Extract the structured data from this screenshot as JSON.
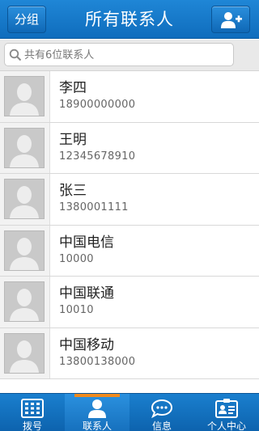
{
  "header": {
    "title": "所有联系人",
    "group_button": "分组",
    "add_icon": "add-contact-icon"
  },
  "search": {
    "placeholder": "共有6位联系人",
    "icon": "search-icon"
  },
  "contacts": [
    {
      "name": "李四",
      "phone": "18900000000"
    },
    {
      "name": "王明",
      "phone": "12345678910"
    },
    {
      "name": "张三",
      "phone": "1380001111"
    },
    {
      "name": "中国电信",
      "phone": "10000"
    },
    {
      "name": "中国联通",
      "phone": "10010"
    },
    {
      "name": "中国移动",
      "phone": "13800138000"
    }
  ],
  "tabs": [
    {
      "label": "拨号",
      "icon": "dialpad-icon",
      "active": false
    },
    {
      "label": "联系人",
      "icon": "person-icon",
      "active": true
    },
    {
      "label": "信息",
      "icon": "message-icon",
      "active": false
    },
    {
      "label": "个人中心",
      "icon": "profile-card-icon",
      "active": false
    }
  ],
  "colors": {
    "header_blue": "#1574c4",
    "active_tab_indicator": "#f08a1d"
  }
}
